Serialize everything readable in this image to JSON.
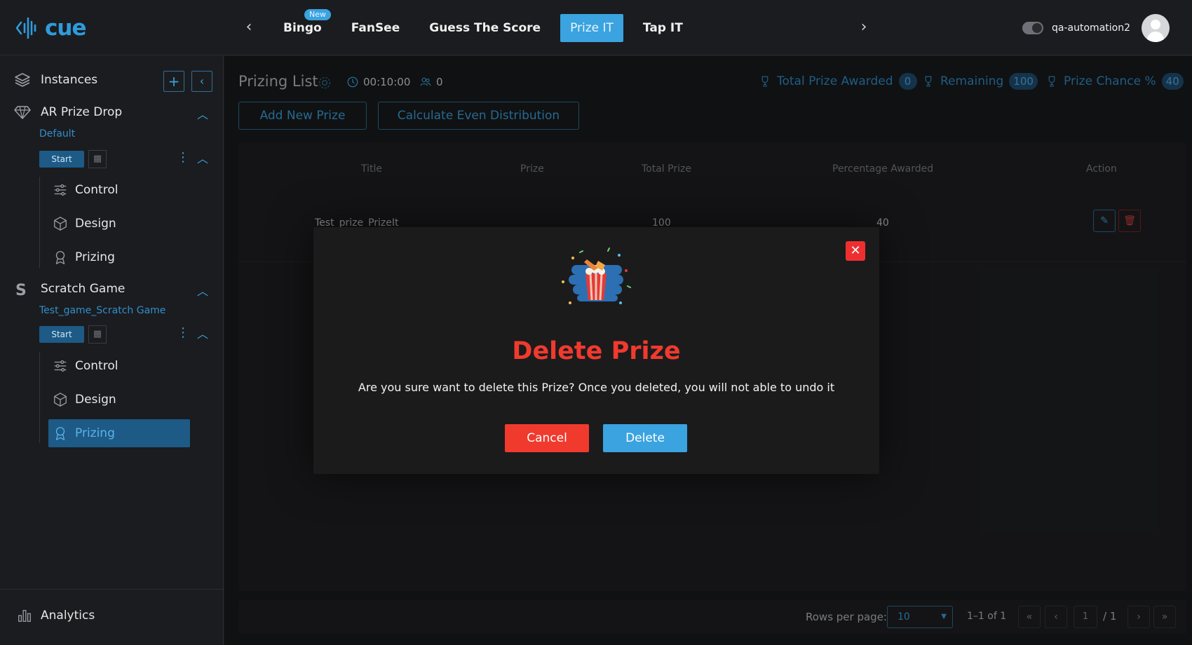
{
  "header": {
    "logo_text": "cue",
    "tabs": [
      {
        "label": "Bingo",
        "badge": "New"
      },
      {
        "label": "FanSee"
      },
      {
        "label": "Guess The Score"
      },
      {
        "label": "Prize IT"
      },
      {
        "label": "Tap IT"
      }
    ],
    "username": "qa-automation2"
  },
  "sidebar": {
    "instances_label": "Instances",
    "groups": [
      {
        "title": "AR Prize Drop",
        "subtitle": "Default",
        "start_label": "Start",
        "items": [
          "Control",
          "Design",
          "Prizing"
        ]
      },
      {
        "title": "Scratch Game",
        "subtitle": "Test_game_Scratch Game",
        "start_label": "Start",
        "items": [
          "Control",
          "Design",
          "Prizing"
        ]
      }
    ],
    "analytics_label": "Analytics"
  },
  "main": {
    "title": "Prizing List",
    "timer": "00:10:00",
    "participants": "0",
    "stats": [
      {
        "label": "Total Prize Awarded",
        "value": "0"
      },
      {
        "label": "Remaining",
        "value": "100"
      },
      {
        "label": "Prize Chance %",
        "value": "40"
      }
    ],
    "add_button": "Add New Prize",
    "calc_button": "Calculate Even Distribution",
    "table": {
      "columns": [
        "Title",
        "Prize",
        "Total Prize",
        "Percentage Awarded",
        "Action"
      ],
      "rows": [
        {
          "title": "Test_prize_PrizeIt",
          "prize": "",
          "total_prize": "100",
          "percentage": "40"
        }
      ]
    },
    "pagination": {
      "rows_per_page_label": "Rows per page:",
      "rows_per_page": "10",
      "range": "1–1 of 1",
      "page": "1",
      "total_pages": "/ 1"
    }
  },
  "modal": {
    "title": "Delete Prize",
    "message": "Are you sure want to delete this Prize? Once you deleted, you will not able to undo it",
    "cancel_label": "Cancel",
    "delete_label": "Delete"
  },
  "colors": {
    "accent": "#3aa3e0",
    "danger": "#f03a2e",
    "background": "#1a1b1d"
  }
}
